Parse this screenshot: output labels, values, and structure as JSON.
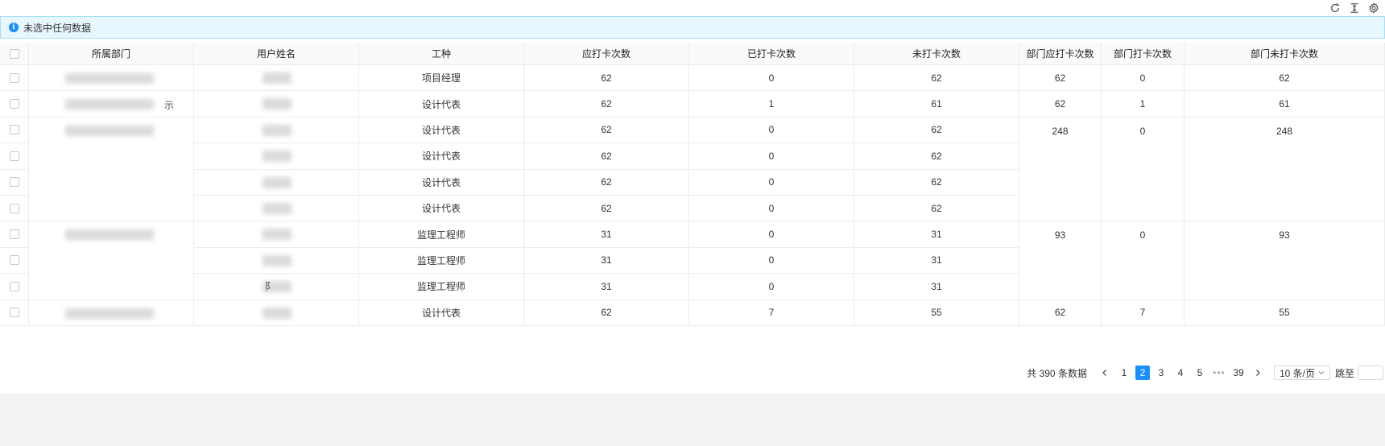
{
  "toolbar": {
    "icons": [
      "refresh-icon",
      "column-height-icon",
      "settings-icon"
    ]
  },
  "alert": {
    "text": "未选中任何数据"
  },
  "table": {
    "columns": [
      "所属部门",
      "用户姓名",
      "工种",
      "应打卡次数",
      "已打卡次数",
      "未打卡次数",
      "部门应打卡次数",
      "部门打卡次数",
      "部门未打卡次数"
    ],
    "rows": [
      {
        "job": "项目经理",
        "expected": "62",
        "done": "0",
        "missed": "62"
      },
      {
        "job": "设计代表",
        "expected": "62",
        "done": "1",
        "missed": "61"
      },
      {
        "job": "设计代表",
        "expected": "62",
        "done": "0",
        "missed": "62"
      },
      {
        "job": "设计代表",
        "expected": "62",
        "done": "0",
        "missed": "62"
      },
      {
        "job": "设计代表",
        "expected": "62",
        "done": "0",
        "missed": "62"
      },
      {
        "job": "设计代表",
        "expected": "62",
        "done": "0",
        "missed": "62"
      },
      {
        "job": "监理工程师",
        "expected": "31",
        "done": "0",
        "missed": "31"
      },
      {
        "job": "监理工程师",
        "expected": "31",
        "done": "0",
        "missed": "31"
      },
      {
        "job": "监理工程师",
        "expected": "31",
        "done": "0",
        "missed": "31"
      },
      {
        "job": "设计代表",
        "expected": "62",
        "done": "7",
        "missed": "55"
      }
    ],
    "dept_groups": [
      {
        "rows": 1,
        "expected": "62",
        "done": "0",
        "missed": "62"
      },
      {
        "rows": 1,
        "expected": "62",
        "done": "1",
        "missed": "61"
      },
      {
        "rows": 4,
        "expected": "248",
        "done": "0",
        "missed": "248"
      },
      {
        "rows": 3,
        "expected": "93",
        "done": "0",
        "missed": "93"
      },
      {
        "rows": 1,
        "expected": "62",
        "done": "7",
        "missed": "55"
      }
    ],
    "name_fragments": [
      "",
      "",
      "",
      "",
      "",
      "",
      "",
      "",
      "阝",
      ""
    ],
    "dept_fragments": [
      "",
      "示",
      "",
      "",
      "",
      "",
      "",
      "",
      "",
      ""
    ]
  },
  "pagination": {
    "total": "共 390 条数据",
    "pages": [
      "1",
      "2",
      "3",
      "4",
      "5",
      "•••",
      "39"
    ],
    "current": "2",
    "page_size": "10 条/页",
    "jump_label": "跳至"
  },
  "colors": {
    "accent": "#1890ff",
    "alert_bg": "#e8f6fd"
  }
}
